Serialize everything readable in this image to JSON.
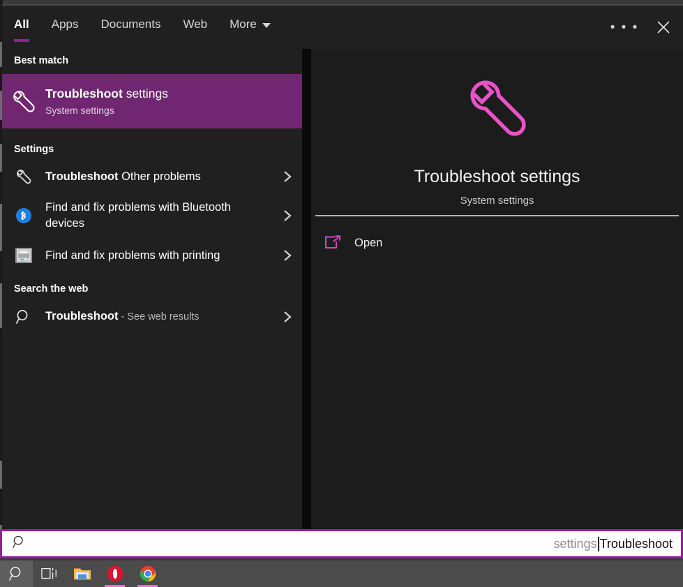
{
  "header": {
    "tabs": [
      {
        "label": "All",
        "icon": "",
        "active": true
      },
      {
        "label": "Apps",
        "icon": "",
        "active": false
      },
      {
        "label": "Documents",
        "icon": "",
        "active": false
      },
      {
        "label": "Web",
        "icon": "",
        "active": false
      },
      {
        "label": "More",
        "icon": "chevron-down-icon",
        "active": false
      }
    ],
    "more_options_label": "• • •",
    "close_label": "✕",
    "accent_color": "#9c1a9c"
  },
  "left_pane": {
    "best_match": {
      "section_title": "Best match",
      "icon": "wrench-icon",
      "title_bold": "Troubleshoot",
      "title_rest": " settings",
      "subtitle": "System settings",
      "highlight_color": "#702670"
    },
    "settings_section": {
      "section_title": "Settings",
      "items": [
        {
          "icon": "wrench-icon",
          "label_bold": "Troubleshoot",
          "label_rest": " Other problems",
          "chevron": "chevron-right-icon"
        },
        {
          "icon": "bluetooth-icon",
          "label_bold": "",
          "label_rest": "Find and fix problems with Bluetooth devices",
          "chevron": "chevron-right-icon"
        },
        {
          "icon": "printer-icon",
          "label_bold": "",
          "label_rest": "Find and fix problems with printing",
          "chevron": "chevron-right-icon"
        }
      ]
    },
    "web_section": {
      "section_title": "Search the web",
      "items": [
        {
          "icon": "search-icon",
          "label_bold": "Troubleshoot",
          "label_dim": " - See web results",
          "chevron": "chevron-right-icon"
        }
      ]
    }
  },
  "right_pane": {
    "hero_icon": "wrench-icon",
    "hero_icon_color": "#e853c8",
    "title": "Troubleshoot settings",
    "subtitle": "System settings",
    "actions": [
      {
        "icon": "open-external-icon",
        "label": "Open"
      }
    ]
  },
  "search_bar": {
    "icon": "search-icon",
    "suggestion_text": "settings",
    "typed_text": "Troubleshoot",
    "border_color": "#9c1a9c"
  },
  "taskbar": {
    "items": [
      {
        "name": "search",
        "icon": "search-icon",
        "active": true,
        "running": false
      },
      {
        "name": "task-view",
        "icon": "task-view-icon",
        "active": false,
        "running": false
      },
      {
        "name": "file-explorer",
        "icon": "folder-icon",
        "active": false,
        "running": false
      },
      {
        "name": "opera",
        "icon": "opera-icon",
        "active": false,
        "running": true
      },
      {
        "name": "chrome",
        "icon": "chrome-icon",
        "active": false,
        "running": true
      }
    ],
    "indicator_color": "#f06ad0"
  }
}
